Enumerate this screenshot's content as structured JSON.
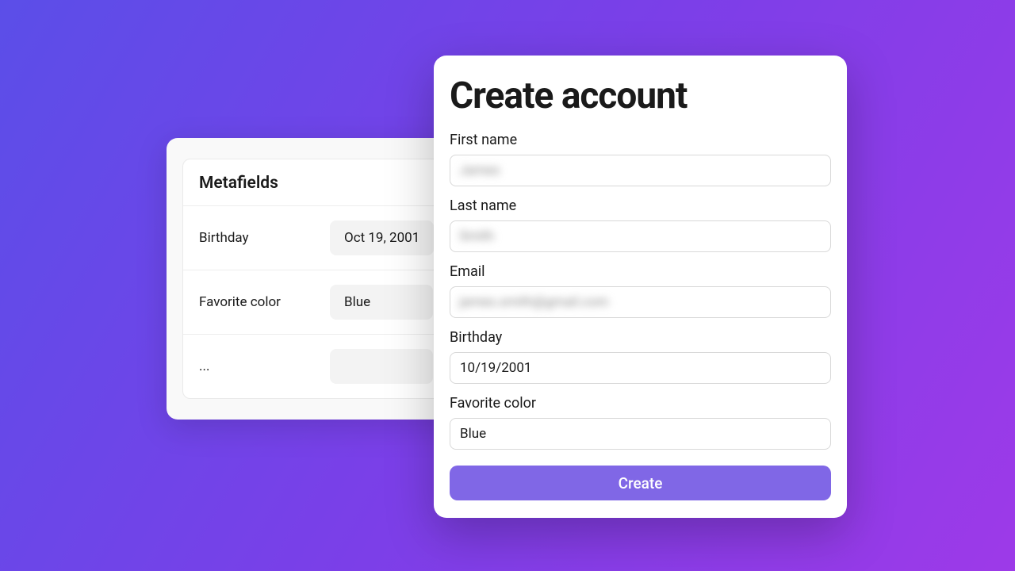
{
  "metafields": {
    "title": "Metafields",
    "rows": [
      {
        "label": "Birthday",
        "value": "Oct 19, 2001"
      },
      {
        "label": "Favorite color",
        "value": "Blue"
      },
      {
        "label": "...",
        "value": ""
      }
    ]
  },
  "form": {
    "title": "Create account",
    "first_name": {
      "label": "First name",
      "value": "James"
    },
    "last_name": {
      "label": "Last name",
      "value": "Smith"
    },
    "email": {
      "label": "Email",
      "value": "james.smith@gmail.com"
    },
    "birthday": {
      "label": "Birthday",
      "value": "10/19/2001"
    },
    "favorite_color": {
      "label": "Favorite color",
      "value": "Blue"
    },
    "submit_label": "Create"
  }
}
